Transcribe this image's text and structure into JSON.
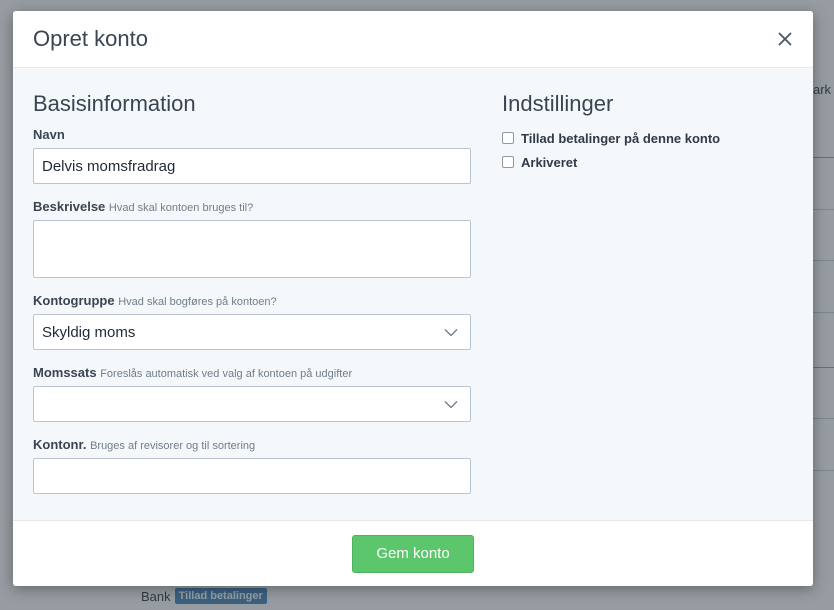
{
  "background": {
    "edge_text": "ark",
    "bank_row": {
      "label": "Bank",
      "badge": "Tillad betalinger"
    }
  },
  "modal": {
    "title": "Opret konto",
    "close_icon": "close-icon"
  },
  "basis": {
    "section_title": "Basisinformation",
    "name": {
      "label": "Navn",
      "value": "Delvis momsfradrag"
    },
    "description": {
      "label": "Beskrivelse",
      "hint": "Hvad skal kontoen bruges til?",
      "value": ""
    },
    "account_group": {
      "label": "Kontogruppe",
      "hint": "Hvad skal bogføres på kontoen?",
      "selected": "Skyldig moms"
    },
    "vat_rate": {
      "label": "Momssats",
      "hint": "Foreslås automatisk ved valg af kontoen på udgifter",
      "selected": ""
    },
    "account_number": {
      "label": "Kontonr.",
      "hint": "Bruges af revisorer og til sortering",
      "value": ""
    }
  },
  "settings": {
    "section_title": "Indstillinger",
    "options": [
      {
        "label": "Tillad betalinger på denne konto",
        "checked": false
      },
      {
        "label": "Arkiveret",
        "checked": false
      }
    ]
  },
  "footer": {
    "save_label": "Gem konto"
  },
  "colors": {
    "primary_button": "#5cc66c",
    "badge": "#3c7eb4",
    "input_border": "#b8c5d0",
    "body_background": "#f5f8fa"
  }
}
